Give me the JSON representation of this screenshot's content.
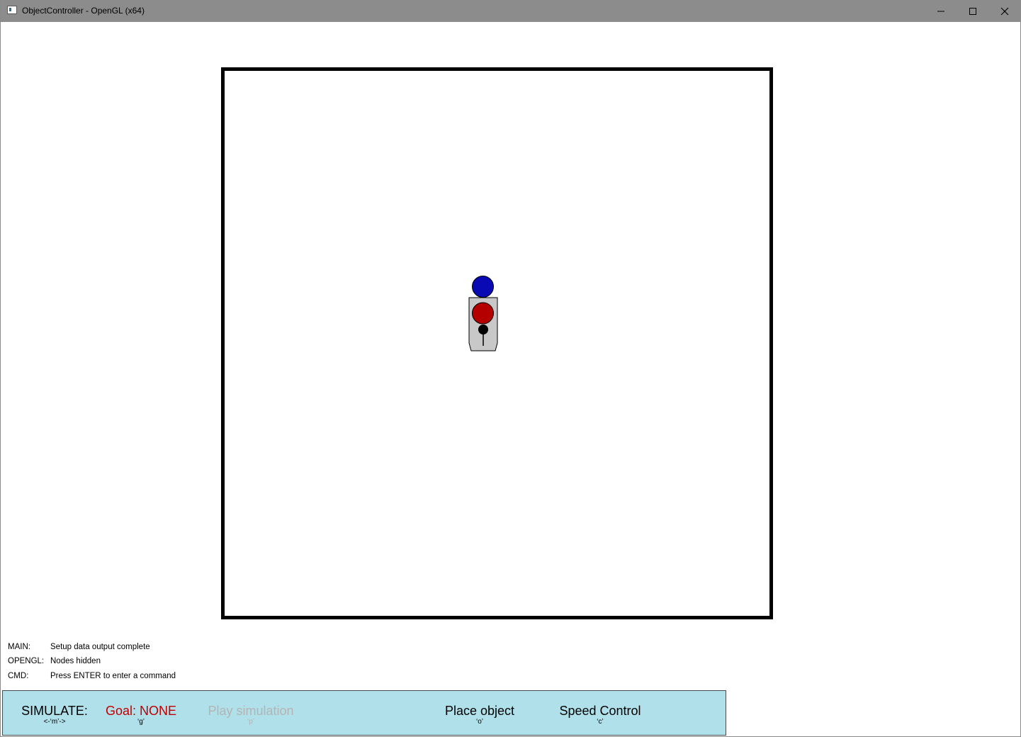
{
  "window": {
    "title": "ObjectController - OpenGL (x64)",
    "minimize_glyph": "—",
    "maximize_glyph": "□",
    "close_glyph": "✕"
  },
  "log": [
    {
      "key": "MAIN:",
      "text": "Setup data output complete"
    },
    {
      "key": "OPENGL:",
      "text": "Nodes hidden"
    },
    {
      "key": "CMD:",
      "text": "Press ENTER to enter a command"
    }
  ],
  "menu": {
    "simulate": {
      "label": "SIMULATE:",
      "key": "<-‘m’->"
    },
    "goal": {
      "label": "Goal: NONE",
      "key": "‘g’",
      "color": "#c00000"
    },
    "play": {
      "label": "Play simulation",
      "key": "‘p’",
      "color": "#b4b4b4"
    },
    "place": {
      "label": "Place object",
      "key": "‘o’"
    },
    "speed": {
      "label": "Speed Control",
      "key": "‘c’"
    },
    "background": "#b0e0ea"
  },
  "scene": {
    "target_color": "#0a0ab4",
    "robot_body_color": "#c8c8c8",
    "robot_marker_color": "#b40000",
    "pivot_color": "#000000"
  }
}
